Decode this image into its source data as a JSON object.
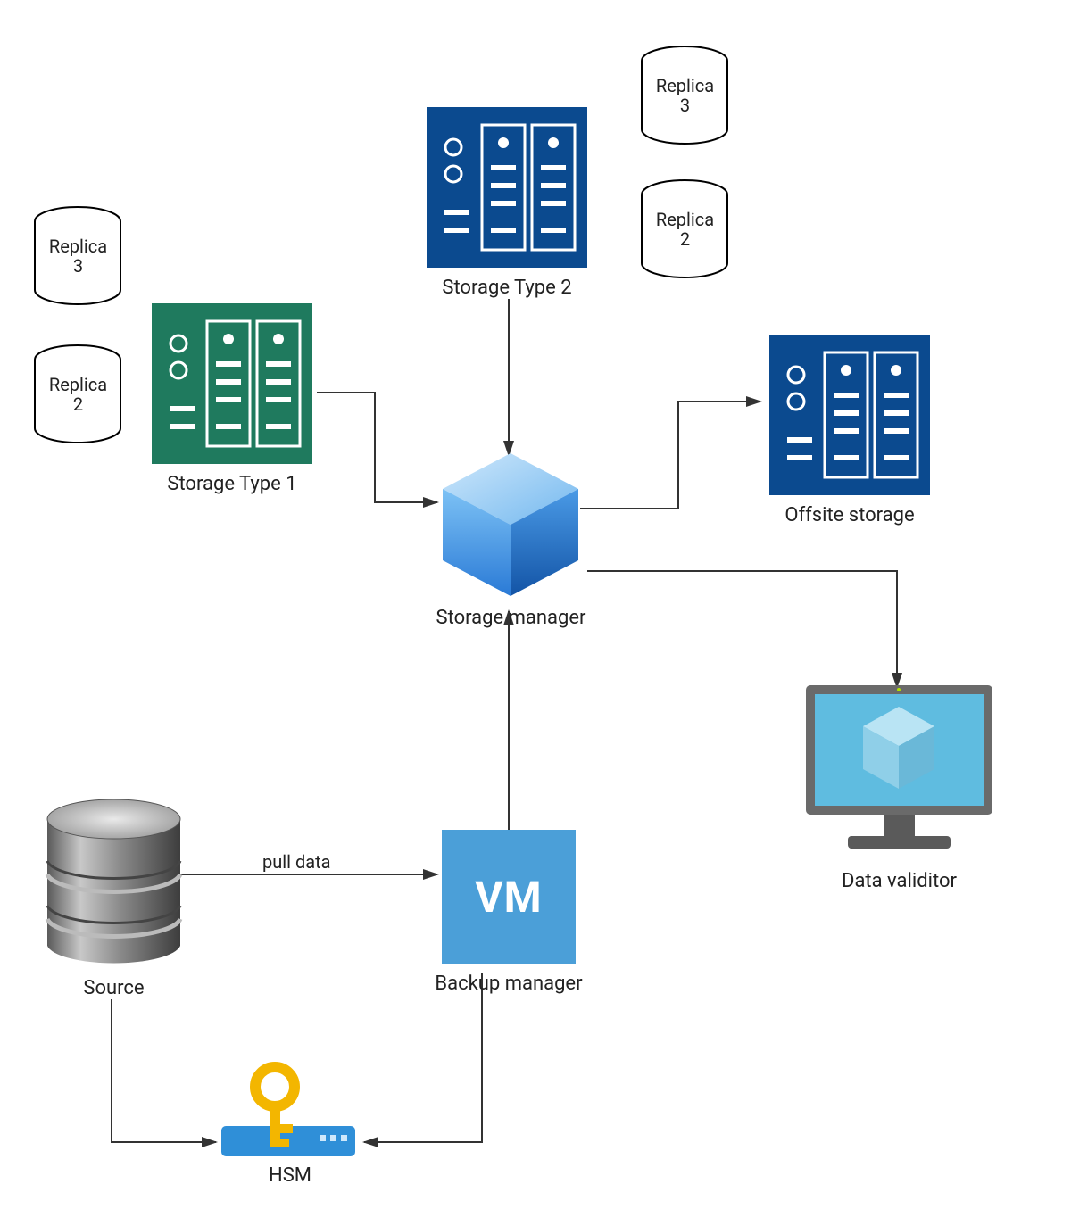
{
  "nodes": {
    "replica3_left": "Replica\n3",
    "replica2_left": "Replica\n2",
    "storage_type_1": "Storage Type 1",
    "storage_type_2": "Storage Type 2",
    "replica3_right": "Replica\n3",
    "replica2_right": "Replica\n2",
    "storage_manager": "Storage manager",
    "offsite_storage": "Offsite storage",
    "data_validitor": "Data validitor",
    "backup_manager": "Backup manager",
    "vm_text": "VM",
    "source": "Source",
    "hsm": "HSM",
    "pull_data": "pull data"
  },
  "colors": {
    "storage1": "#1f7a5e",
    "storage2": "#0b4a8f",
    "offsite": "#0b4a8f",
    "cube_light": "#6fb8ef",
    "cube_dark": "#1a6ed8",
    "vm_bg": "#4b9fd8",
    "hsm_blue": "#2f8fd8",
    "key_gold": "#f3b600",
    "monitor_frame": "#6a6a6a",
    "monitor_screen": "#5fbce0",
    "db_gray": "#808080",
    "db_light": "#bdbdbd"
  }
}
